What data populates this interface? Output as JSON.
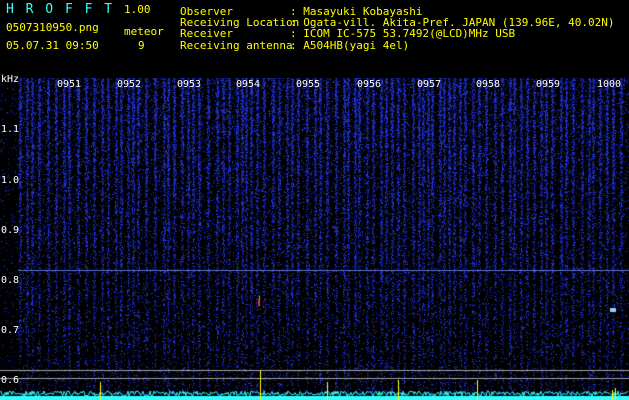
{
  "header": {
    "app_title": "H R O F F T",
    "version": "1.00",
    "filename": "0507310950.png",
    "mode": "meteor",
    "datetime": "05.07.31 09:50",
    "count": "9",
    "observer_label": "Observer",
    "observer_value": ": Masayuki Kobayashi",
    "location_label": "Receiving Location",
    "location_value": ": Ogata-vill. Akita-Pref. JAPAN (139.96E, 40.02N)",
    "receiver_label": "Receiver",
    "receiver_value": ": ICOM IC-575 53.7492(@LCD)MHz USB",
    "antenna_label": "Receiving antenna",
    "antenna_value": ": A504HB(yagi 4el)"
  },
  "axis": {
    "y_unit": "kHz",
    "y_ticks": [
      "1.1",
      "1.0",
      "0.9",
      "0.8",
      "0.7",
      "0.6"
    ],
    "x_ticks": [
      "0951",
      "0952",
      "0953",
      "0954",
      "0955",
      "0956",
      "0957",
      "0958",
      "0959",
      "1000"
    ]
  },
  "colors": {
    "background": "#000000",
    "spectrum_blue": "#1a2cff",
    "trace_cyan": "#33ffff",
    "marker_yellow": "#ffff00"
  }
}
